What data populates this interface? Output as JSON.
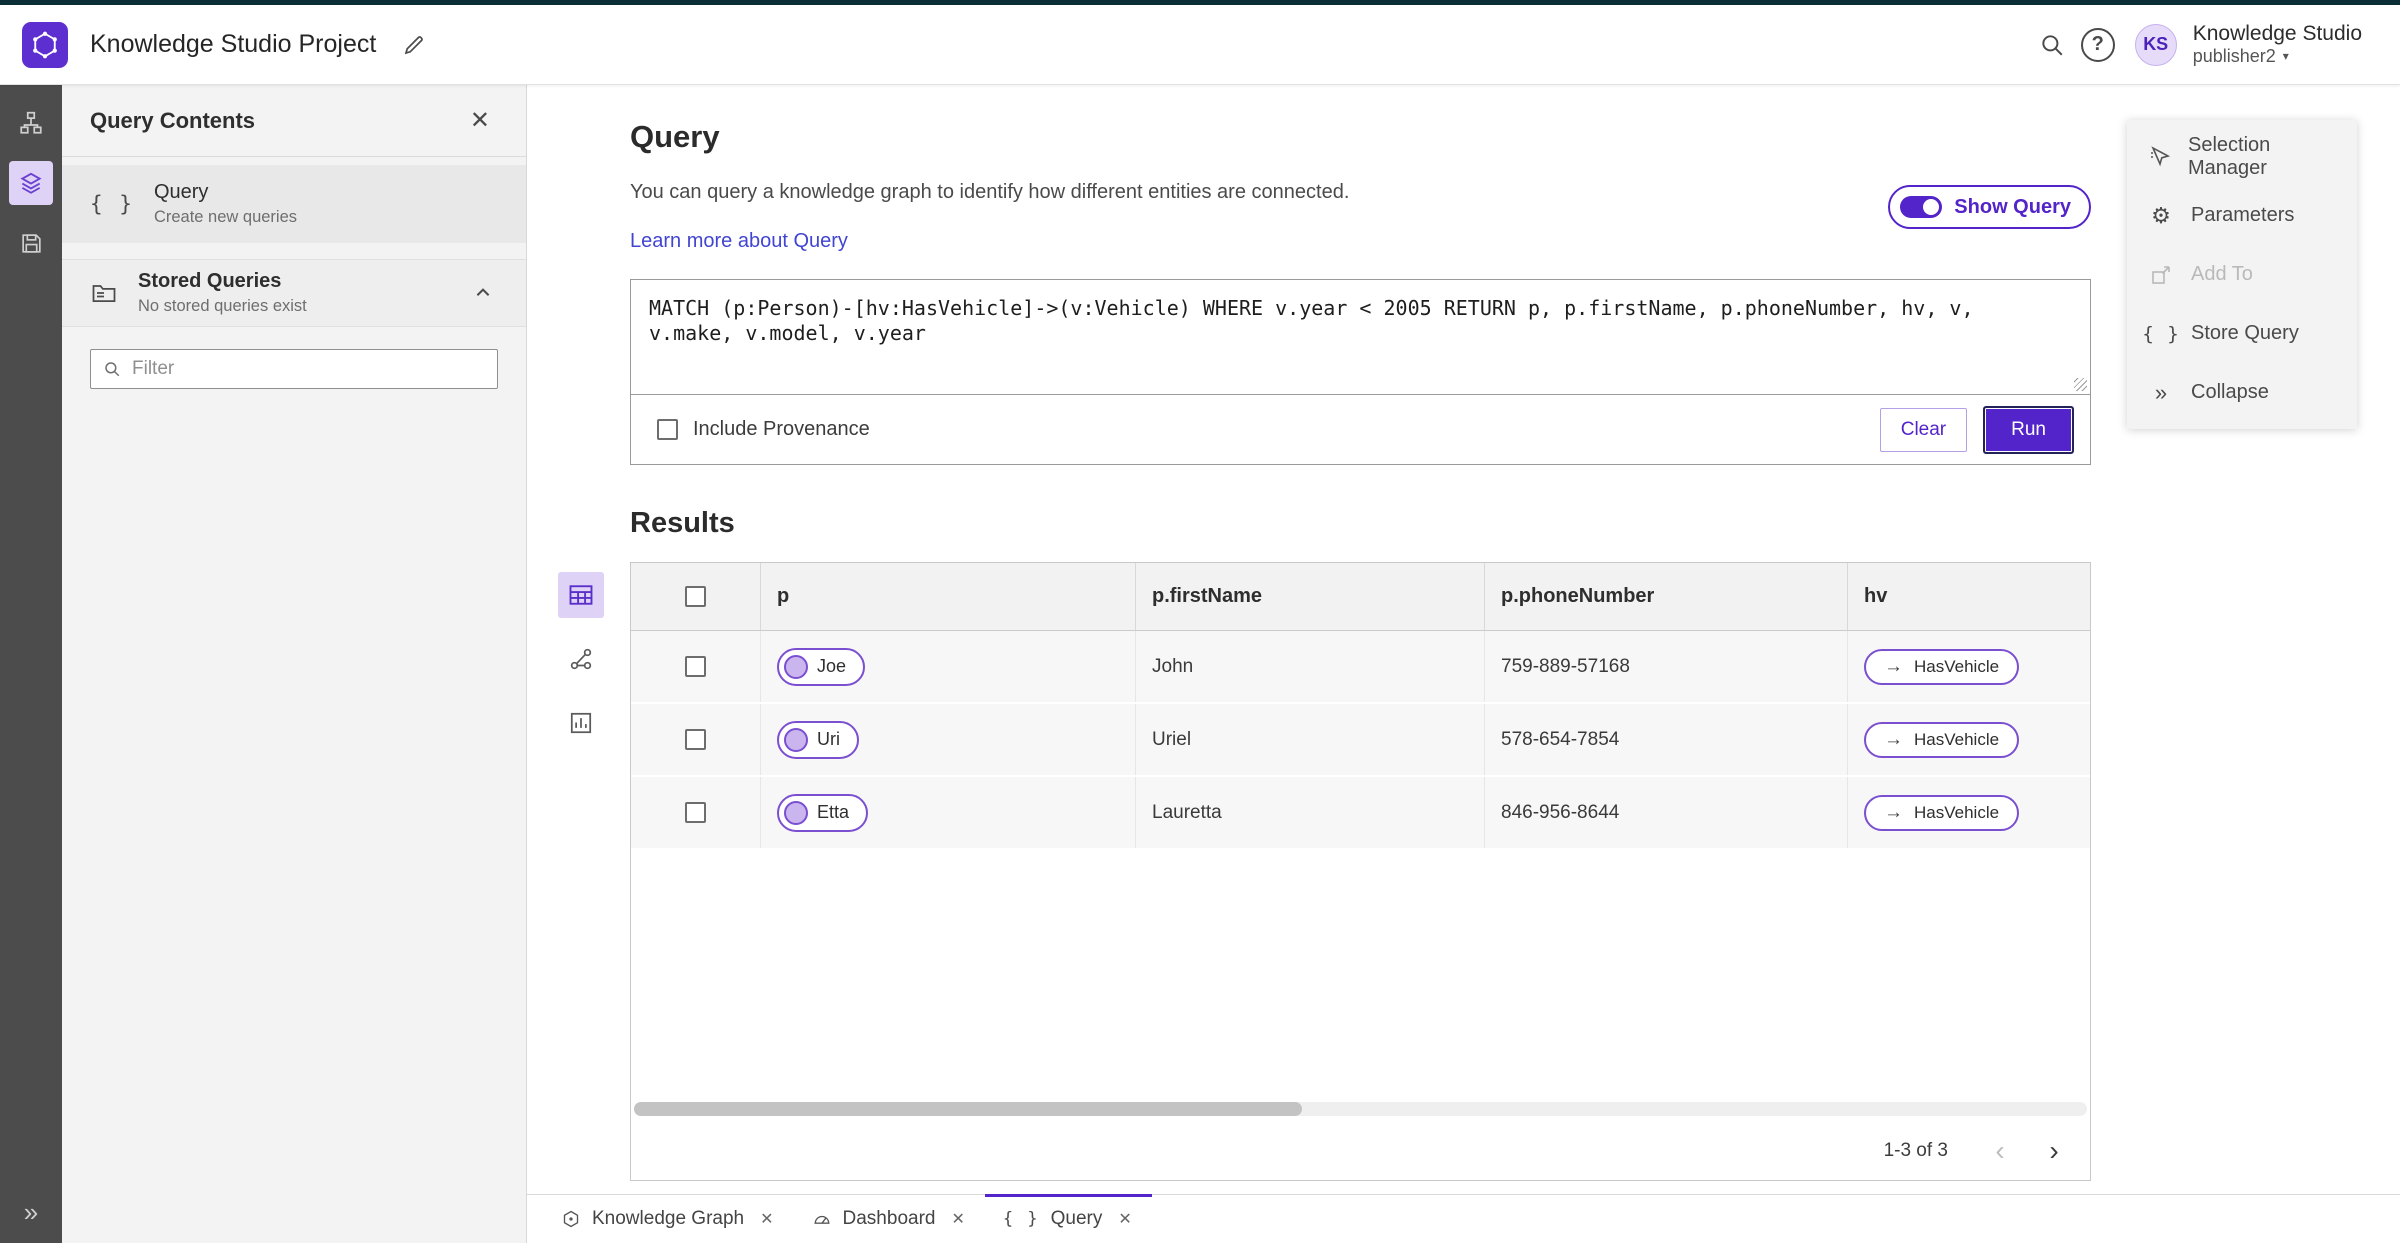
{
  "header": {
    "app_title": "Knowledge Studio Project",
    "account_initials": "KS",
    "account_org": "Knowledge Studio",
    "account_user": "publisher2"
  },
  "left_panel": {
    "title": "Query Contents",
    "query_item": {
      "label": "Query",
      "sublabel": "Create new queries"
    },
    "stored_queries": {
      "label": "Stored Queries",
      "sublabel": "No stored queries exist"
    },
    "filter_placeholder": "Filter"
  },
  "query_section": {
    "title": "Query",
    "description": "You can query a knowledge graph to identify how different entities are connected.",
    "learn_more": "Learn more about Query",
    "show_query_label": "Show Query",
    "query_text": "MATCH (p:Person)-[hv:HasVehicle]->(v:Vehicle) WHERE v.year < 2005 RETURN p, p.firstName, p.phoneNumber, hv, v, v.make, v.model, v.year",
    "include_provenance_label": "Include Provenance",
    "clear_label": "Clear",
    "run_label": "Run"
  },
  "results": {
    "title": "Results",
    "columns": [
      "p",
      "p.firstName",
      "p.phoneNumber",
      "hv"
    ],
    "rows": [
      {
        "p": "Joe",
        "firstName": "John",
        "phoneNumber": "759-889-57168",
        "hv": "HasVehicle"
      },
      {
        "p": "Uri",
        "firstName": "Uriel",
        "phoneNumber": "578-654-7854",
        "hv": "HasVehicle"
      },
      {
        "p": "Etta",
        "firstName": "Lauretta",
        "phoneNumber": "846-956-8644",
        "hv": "HasVehicle"
      }
    ],
    "pagination": "1-3 of 3"
  },
  "right_panel": {
    "items": [
      {
        "label": "Selection Manager",
        "disabled": false
      },
      {
        "label": "Parameters",
        "disabled": false
      },
      {
        "label": "Add To",
        "disabled": true
      },
      {
        "label": "Store Query",
        "disabled": false
      },
      {
        "label": "Collapse",
        "disabled": false
      }
    ]
  },
  "bottom_tabs": [
    {
      "label": "Knowledge Graph",
      "active": false
    },
    {
      "label": "Dashboard",
      "active": false
    },
    {
      "label": "Query",
      "active": true
    }
  ],
  "colors": {
    "accent": "#5324c9",
    "accent_light": "#ded2f6",
    "pill_border": "#7a4fd0",
    "pill_fill": "#cbb5ee",
    "link": "#4145d1",
    "top_strip": "#0b2e36",
    "rail_bg": "#4c4c4c",
    "panel_bg": "#f3f3f3"
  }
}
